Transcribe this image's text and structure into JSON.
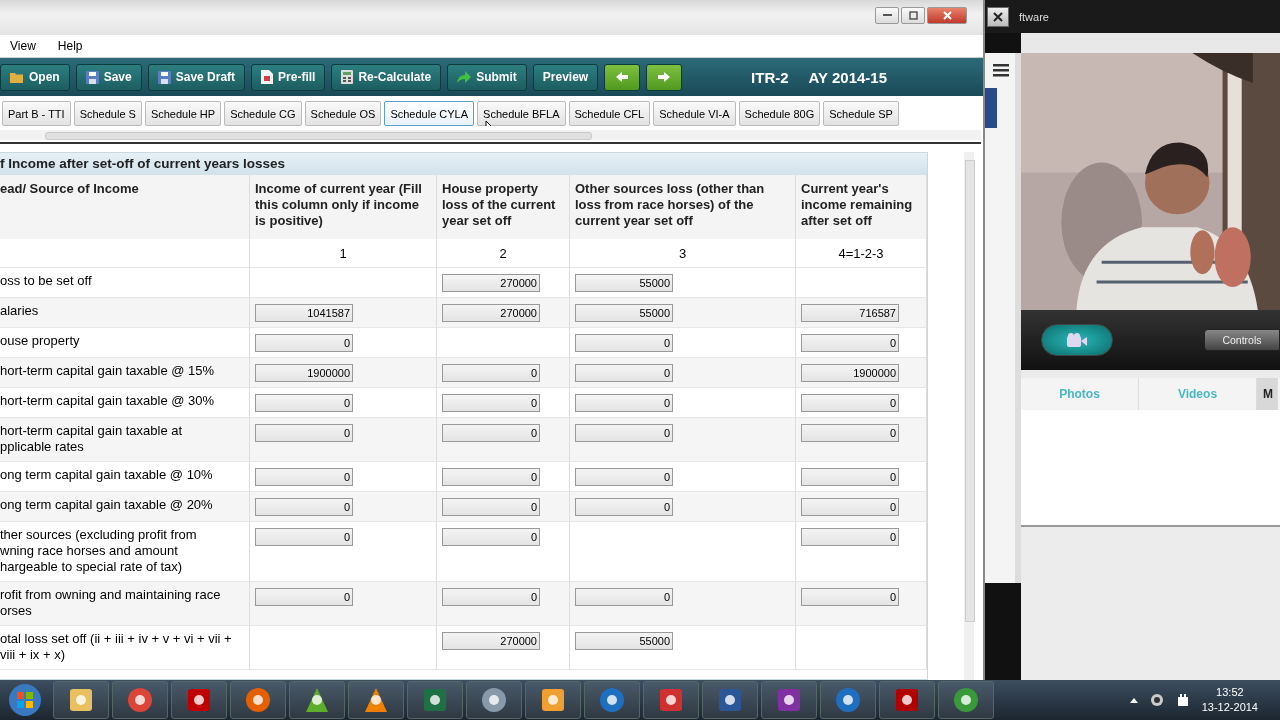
{
  "app": {
    "menu": [
      "View",
      "Help"
    ],
    "toolbar": [
      {
        "kind": "open",
        "label": "Open"
      },
      {
        "kind": "save",
        "label": "Save"
      },
      {
        "kind": "draft",
        "label": "Save Draft"
      },
      {
        "kind": "prefill",
        "label": "Pre-fill"
      },
      {
        "kind": "calc",
        "label": "Re-Calculate"
      },
      {
        "kind": "submit",
        "label": "Submit"
      },
      {
        "kind": "preview",
        "label": "Preview"
      },
      {
        "kind": "back"
      },
      {
        "kind": "forward"
      }
    ],
    "form_id": "ITR-2",
    "assessment_year": "AY 2014-15",
    "tabs": [
      {
        "label": "Part B - TTI",
        "selected": false
      },
      {
        "label": "Schedule S",
        "selected": false
      },
      {
        "label": "Schedule HP",
        "selected": false
      },
      {
        "label": "Schedule CG",
        "selected": false
      },
      {
        "label": "Schedule OS",
        "selected": false
      },
      {
        "label": "Schedule CYLA",
        "selected": true
      },
      {
        "label": "Schedule BFLA",
        "selected": false
      },
      {
        "label": "Schedule CFL",
        "selected": false
      },
      {
        "label": "Schedule VI-A",
        "selected": false
      },
      {
        "label": "Schedule 80G",
        "selected": false
      },
      {
        "label": "Schedule SP",
        "selected": false
      }
    ],
    "section_title": "f Income after set-off of current years losses",
    "table": {
      "columns": [
        "ead/ Source of Income",
        "Income of current year (Fill this column only if income is positive)",
        "House property loss of the current year set off",
        "Other sources loss (other than loss from race horses) of the current year set off",
        "Current year's income remaining after set off"
      ],
      "column_numbers": [
        "1",
        "2",
        "3",
        "4=1-2-3"
      ],
      "rows": [
        {
          "cells": [
            "oss to be set off",
            "",
            "270000",
            "55000",
            ""
          ]
        },
        {
          "cells": [
            "alaries",
            "1041587",
            "270000",
            "55000",
            "716587"
          ]
        },
        {
          "cells": [
            "ouse property",
            "0",
            "",
            "0",
            "0"
          ]
        },
        {
          "cells": [
            "hort-term capital gain taxable @ 15%",
            "1900000",
            "0",
            "0",
            "1900000"
          ]
        },
        {
          "cells": [
            "hort-term capital gain taxable @ 30%",
            "0",
            "0",
            "0",
            "0"
          ]
        },
        {
          "cells": [
            "hort-term capital gain taxable at\npplicable rates",
            "0",
            "0",
            "0",
            "0"
          ]
        },
        {
          "cells": [
            "ong term capital gain taxable @ 10%",
            "0",
            "0",
            "0",
            "0"
          ]
        },
        {
          "cells": [
            "ong term capital gain taxable @ 20%",
            "0",
            "0",
            "0",
            "0"
          ]
        },
        {
          "cells": [
            "ther sources (excluding profit from\nwning race horses and amount\nhargeable to special rate of tax)",
            "0",
            "0",
            "",
            "0"
          ]
        },
        {
          "cells": [
            "rofit from owning and maintaining race\norses",
            "0",
            "0",
            "0",
            "0"
          ]
        },
        {
          "cells": [
            "otal loss set off (ii + iii + iv + v + vi + vii + viii + ix + x)",
            "",
            "270000",
            "55000",
            ""
          ]
        }
      ]
    }
  },
  "other_window": {
    "title": "ftware"
  },
  "webcam": {
    "controls_button": "Controls",
    "tabs": [
      {
        "label": "Photos",
        "selected": false
      },
      {
        "label": "Videos",
        "selected": false
      },
      {
        "label": "M",
        "selected": true
      }
    ]
  },
  "taskbar": {
    "time": "13:52",
    "date": "13-12-2014"
  }
}
